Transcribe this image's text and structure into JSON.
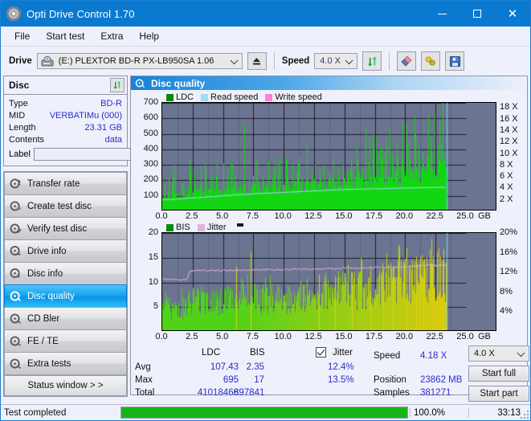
{
  "window": {
    "title": "Opti Drive Control 1.70",
    "icon": "disc-icon",
    "minimize": "minimize-icon",
    "maximize": "maximize-icon",
    "close": "close-icon"
  },
  "menu": {
    "items": [
      "File",
      "Start test",
      "Extra",
      "Help"
    ]
  },
  "toolbar": {
    "drive_label": "Drive",
    "drive_value": "(E:)   PLEXTOR BD-R  PX-LB950SA 1.06",
    "eject_icon": "eject-icon",
    "speed_label": "Speed",
    "speed_value": "4.0 X",
    "refresh_icon": "refresh-icon",
    "eraser_icon": "eraser-icon",
    "bell_icon": "bell-icon",
    "save_icon": "save-icon"
  },
  "disc": {
    "title": "Disc",
    "refresh_icon": "refresh-icon",
    "rows": [
      {
        "key": "Type",
        "value": "BD-R"
      },
      {
        "key": "MID",
        "value": "VERBATIMu (000)"
      },
      {
        "key": "Length",
        "value": "23.31 GB"
      },
      {
        "key": "Contents",
        "value": "data"
      }
    ],
    "label_key": "Label",
    "label_value": "",
    "label_icon": "disc-label-icon"
  },
  "nav": {
    "items": [
      {
        "label": "Transfer rate",
        "icon": "disc-test-icon",
        "selected": false
      },
      {
        "label": "Create test disc",
        "icon": "disc-burn-icon",
        "selected": false
      },
      {
        "label": "Verify test disc",
        "icon": "disc-verify-icon",
        "selected": false
      },
      {
        "label": "Drive info",
        "icon": "drive-info-icon",
        "selected": false
      },
      {
        "label": "Disc info",
        "icon": "disc-info-icon",
        "selected": false
      },
      {
        "label": "Disc quality",
        "icon": "disc-quality-icon",
        "selected": true
      },
      {
        "label": "CD Bler",
        "icon": "cd-bler-icon",
        "selected": false
      },
      {
        "label": "FE / TE",
        "icon": "fe-te-icon",
        "selected": false
      },
      {
        "label": "Extra tests",
        "icon": "extra-tests-icon",
        "selected": false
      }
    ],
    "status_window": "Status window > >"
  },
  "panel": {
    "title": "Disc quality",
    "icon": "disc-quality-icon"
  },
  "stats": {
    "col_ldc": "LDC",
    "col_bis": "BIS",
    "jitter_label": "Jitter",
    "jitter_checked": true,
    "rows": [
      {
        "name": "Avg",
        "ldc": "107.43",
        "bis": "2.35",
        "jitter": "12.4%"
      },
      {
        "name": "Max",
        "ldc": "695",
        "bis": "17",
        "jitter": "13.5%"
      },
      {
        "name": "Total",
        "ldc": "41018466",
        "bis": "897841",
        "jitter": ""
      }
    ],
    "speed_label": "Speed",
    "speed_value": "4.18 X",
    "position_label": "Position",
    "position_value": "23862 MB",
    "samples_label": "Samples",
    "samples_value": "381271",
    "speed_select": "4.0 X",
    "start_full": "Start full",
    "start_part": "Start part"
  },
  "statusbar": {
    "status": "Test completed",
    "progress_pct": "100.0%",
    "progress_value": 100,
    "elapsed": "33:13"
  },
  "colors": {
    "accent": "#0a7ad1",
    "plot_bg": "#6b7490",
    "ldc_green": "#13d613",
    "bis_green": "#35c712",
    "jitter_pink": "#e0b4e0",
    "read_speed": "#9fdcf5",
    "write_speed": "#ff7fe0",
    "value_blue": "#2c2ccd",
    "progress_green": "#17b417"
  },
  "chart_data": [
    {
      "id": "top-chart",
      "type": "area",
      "title": "",
      "xlabel": "GB",
      "ylabel": "LDC",
      "xlim": [
        0,
        25
      ],
      "xticks": [
        0.0,
        2.5,
        5.0,
        7.5,
        10.0,
        12.5,
        15.0,
        17.5,
        20.0,
        22.5,
        25.0
      ],
      "xticklabels": [
        "0.0",
        "2.5",
        "5.0",
        "7.5",
        "10.0",
        "12.5",
        "15.0",
        "17.5",
        "20.0",
        "22.5",
        "25.0"
      ],
      "ylim": [
        0,
        700
      ],
      "yticks": [
        100,
        200,
        300,
        400,
        500,
        600,
        700
      ],
      "y2label": "X",
      "y2lim": [
        0,
        18.9
      ],
      "y2ticks": [
        2,
        4,
        6,
        8,
        10,
        12,
        14,
        16,
        18
      ],
      "y2ticklabels": [
        "2 X",
        "4 X",
        "6 X",
        "8 X",
        "10 X",
        "12 X",
        "14 X",
        "16 X",
        "18 X"
      ],
      "grid": true,
      "legend": [
        {
          "name": "LDC",
          "color": "#0a8a0a",
          "type": "area"
        },
        {
          "name": "Read speed",
          "color": "#9fdcf5",
          "type": "line"
        },
        {
          "name": "Write speed",
          "color": "#ff7fe0",
          "type": "line"
        }
      ],
      "data_end_gb": 23.4,
      "series": [
        {
          "name": "LDC",
          "color": "#13d613",
          "type": "area",
          "x": [
            0.0,
            0.3,
            0.6,
            0.9,
            1.2,
            1.5,
            1.8,
            2.1,
            2.4,
            2.7,
            3.0,
            3.3,
            3.6,
            3.9,
            4.2,
            4.5,
            4.8,
            5.1,
            5.4,
            5.7,
            6.0,
            6.3,
            6.6,
            6.9,
            7.2,
            7.5,
            7.8,
            8.1,
            8.4,
            8.7,
            9.0,
            9.3,
            9.6,
            9.9,
            10.2,
            10.5,
            10.8,
            11.1,
            11.4,
            11.7,
            12.0,
            12.3,
            12.6,
            12.9,
            13.2,
            13.5,
            13.8,
            14.1,
            14.4,
            14.7,
            15.0,
            15.3,
            15.6,
            15.9,
            16.2,
            16.5,
            16.8,
            17.1,
            17.4,
            17.7,
            18.0,
            18.3,
            18.6,
            18.9,
            19.2,
            19.5,
            19.8,
            20.1,
            20.4,
            20.7,
            21.0,
            21.3,
            21.6,
            21.9,
            22.2,
            22.5,
            22.8,
            23.1,
            23.4
          ],
          "values": [
            90,
            95,
            100,
            110,
            95,
            100,
            105,
            120,
            130,
            125,
            120,
            125,
            130,
            125,
            130,
            128,
            130,
            135,
            130,
            132,
            138,
            135,
            140,
            138,
            142,
            140,
            145,
            142,
            148,
            145,
            150,
            148,
            152,
            150,
            155,
            152,
            158,
            155,
            160,
            158,
            162,
            160,
            165,
            162,
            168,
            170,
            172,
            175,
            178,
            180,
            182,
            185,
            188,
            190,
            195,
            198,
            200,
            205,
            210,
            212,
            215,
            218,
            220,
            225,
            228,
            232,
            235,
            240,
            245,
            248,
            250,
            255,
            258,
            262,
            265,
            270,
            275,
            280,
            262
          ],
          "peaks_x": [
            0.55,
            1.05,
            1.75,
            2.25,
            2.55,
            3.1,
            3.5,
            3.95,
            4.4,
            5.05,
            5.45,
            5.95,
            6.35,
            6.75,
            7.15,
            7.45,
            7.9,
            8.3,
            8.6,
            9.05,
            9.5,
            9.9,
            10.3,
            10.7,
            11.1,
            11.5,
            11.9,
            12.3,
            12.55,
            12.95,
            13.3,
            13.75,
            14.1,
            14.5,
            14.9,
            15.3,
            15.7,
            16.1,
            16.5,
            16.9,
            17.3,
            17.7,
            18.1,
            18.5,
            18.9,
            19.3,
            19.7,
            20.1,
            20.4,
            20.8,
            21.1,
            21.45,
            21.8,
            22.1,
            22.4,
            22.7,
            22.95,
            23.2
          ],
          "peaks_y": [
            220,
            300,
            190,
            330,
            245,
            180,
            320,
            200,
            230,
            310,
            195,
            245,
            200,
            565,
            215,
            230,
            200,
            230,
            190,
            215,
            200,
            215,
            210,
            230,
            250,
            215,
            435,
            250,
            300,
            260,
            300,
            245,
            350,
            280,
            300,
            260,
            270,
            330,
            280,
            320,
            500,
            350,
            300,
            420,
            370,
            455,
            350,
            560,
            330,
            620,
            420,
            380,
            360,
            480,
            640,
            420,
            450,
            380
          ]
        },
        {
          "name": "Read speed",
          "color": "#9fdcf5",
          "type": "line",
          "x": [
            0.0,
            1.0,
            2.0,
            3.0,
            4.0,
            5.0,
            6.0,
            7.0,
            8.0,
            9.0,
            10.0,
            11.0,
            12.0,
            13.0,
            14.0,
            15.0,
            16.0,
            17.0,
            18.0,
            19.0,
            20.0,
            21.0,
            22.0,
            23.0,
            23.4
          ],
          "values": [
            2.0,
            2.1,
            2.25,
            2.4,
            2.55,
            2.7,
            2.85,
            3.0,
            3.1,
            3.2,
            3.3,
            3.4,
            3.5,
            3.6,
            3.7,
            3.8,
            3.85,
            3.9,
            3.95,
            4.0,
            4.05,
            4.1,
            4.15,
            4.18,
            4.18
          ]
        }
      ],
      "cursor_x_gb": 23.4
    },
    {
      "id": "bottom-chart",
      "type": "area",
      "title": "",
      "xlabel": "GB",
      "ylabel": "BIS",
      "xlim": [
        0,
        25
      ],
      "xticks": [
        0.0,
        2.5,
        5.0,
        7.5,
        10.0,
        12.5,
        15.0,
        17.5,
        20.0,
        22.5,
        25.0
      ],
      "xticklabels": [
        "0.0",
        "2.5",
        "5.0",
        "7.5",
        "10.0",
        "12.5",
        "15.0",
        "17.5",
        "20.0",
        "22.5",
        "25.0"
      ],
      "ylim": [
        0,
        20
      ],
      "yticks": [
        5,
        10,
        15,
        20
      ],
      "y2label": "%",
      "y2lim": [
        0,
        20
      ],
      "y2ticks": [
        4,
        8,
        12,
        16,
        20
      ],
      "y2ticklabels": [
        "4%",
        "8%",
        "12%",
        "16%",
        "20%"
      ],
      "grid": true,
      "legend": [
        {
          "name": "BIS",
          "color": "#0a8a0a",
          "type": "area"
        },
        {
          "name": "Jitter",
          "color": "#e0b4e0",
          "type": "line"
        }
      ],
      "data_end_gb": 23.4,
      "series": [
        {
          "name": "BIS",
          "color": "#6fd61a",
          "type": "area",
          "x": [
            0.0,
            0.4,
            0.8,
            1.2,
            1.6,
            2.0,
            2.4,
            2.8,
            3.2,
            3.6,
            4.0,
            4.4,
            4.8,
            5.2,
            5.6,
            6.0,
            6.4,
            6.8,
            7.2,
            7.6,
            8.0,
            8.4,
            8.8,
            9.2,
            9.6,
            10.0,
            10.4,
            10.8,
            11.2,
            11.6,
            12.0,
            12.4,
            12.8,
            13.2,
            13.6,
            14.0,
            14.4,
            14.8,
            15.2,
            15.6,
            16.0,
            16.4,
            16.8,
            17.2,
            17.6,
            18.0,
            18.4,
            18.8,
            19.2,
            19.6,
            20.0,
            20.4,
            20.8,
            21.2,
            21.6,
            22.0,
            22.4,
            22.8,
            23.2,
            23.4
          ],
          "values": [
            6.0,
            5.6,
            5.2,
            5.0,
            5.4,
            6.2,
            6.6,
            6.5,
            6.7,
            6.6,
            6.8,
            6.7,
            6.9,
            6.8,
            7.0,
            6.9,
            7.1,
            7.0,
            7.2,
            7.1,
            7.3,
            7.2,
            7.4,
            7.3,
            7.5,
            7.4,
            7.6,
            7.5,
            7.7,
            7.6,
            7.8,
            7.7,
            7.9,
            8.0,
            8.2,
            8.4,
            8.6,
            8.8,
            9.0,
            9.1,
            9.3,
            9.4,
            9.6,
            9.8,
            10.0,
            10.2,
            10.4,
            10.6,
            10.8,
            11.0,
            11.2,
            11.4,
            11.6,
            11.8,
            12.0,
            12.2,
            12.4,
            12.6,
            12.8,
            12.4
          ]
        },
        {
          "name": "Jitter",
          "color": "#e0b4e0",
          "type": "line",
          "x": [
            0.0,
            0.5,
            1.0,
            1.5,
            2.0,
            2.3,
            2.6,
            3.0,
            3.5,
            4.0,
            4.5,
            5.0,
            5.5,
            6.0,
            6.5,
            7.0,
            7.5,
            8.0,
            8.5,
            9.0,
            9.5,
            10.0,
            10.5,
            11.0,
            11.5,
            12.0,
            12.5,
            13.0,
            13.5,
            14.0,
            14.5,
            15.0,
            15.5,
            16.0,
            16.5,
            17.0,
            17.5,
            18.0,
            18.5,
            19.0,
            19.5,
            20.0,
            20.5,
            21.0,
            21.5,
            22.0,
            22.5,
            23.0,
            23.4
          ],
          "values": [
            10.8,
            10.6,
            10.6,
            10.5,
            10.5,
            12.4,
            12.4,
            12.4,
            12.4,
            12.4,
            12.4,
            12.4,
            12.4,
            12.4,
            12.5,
            12.5,
            12.5,
            12.5,
            12.6,
            12.6,
            12.6,
            12.6,
            12.6,
            12.7,
            12.7,
            12.7,
            12.7,
            12.7,
            12.8,
            12.8,
            12.8,
            12.9,
            12.9,
            12.9,
            12.9,
            12.9,
            13.0,
            13.0,
            13.0,
            13.0,
            13.1,
            13.1,
            13.2,
            13.3,
            13.4,
            13.5,
            13.4,
            13.5,
            13.5
          ]
        }
      ],
      "cursor_x_gb": 23.4
    }
  ]
}
